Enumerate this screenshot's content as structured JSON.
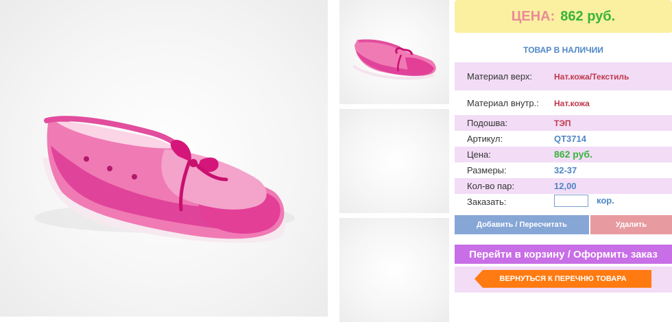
{
  "product": {
    "price_label": "ЦЕНА:",
    "price_value": "862 руб.",
    "stock_status": "ТОВАР В НАЛИЧИИ"
  },
  "specs": [
    {
      "label": "Материал верх:",
      "value": "Нат.кожа/Текстиль"
    },
    {
      "label": "Материал внутр.:",
      "value": "Нат.кожа"
    },
    {
      "label": "Подошва:",
      "value": "ТЭП"
    },
    {
      "label": "Артикул:",
      "value": "QT3714"
    },
    {
      "label": "Цена:",
      "value": "862 руб."
    },
    {
      "label": "Размеры:",
      "value": "32-37"
    },
    {
      "label": "Кол-во пар:",
      "value": "12,00"
    }
  ],
  "order": {
    "label": "Заказать:",
    "quantity_value": "",
    "unit": "кор."
  },
  "buttons": {
    "add": "Добавить / Пересчитать",
    "remove": "Удалить",
    "cart": "Перейти в корзину / Оформить заказ",
    "back": "ВЕРНУТЬСЯ К ПЕРЕЧНЮ ТОВАРА"
  },
  "colors": {
    "price_box_bg": "#fbf0a0",
    "price_label": "#e98a9a",
    "price_value": "#37b43a",
    "accent_blue": "#4f86c6",
    "add_button": "#86a6d6",
    "remove_button": "#e79ba0",
    "cart_button": "#c86ee6",
    "back_button": "#ff7b12",
    "row_highlight": "#f2dcf6"
  },
  "images": {
    "main": "pink-shoe-photo",
    "thumbnails": [
      "pink-shoe-thumbnail",
      "empty-thumbnail",
      "empty-thumbnail"
    ]
  }
}
